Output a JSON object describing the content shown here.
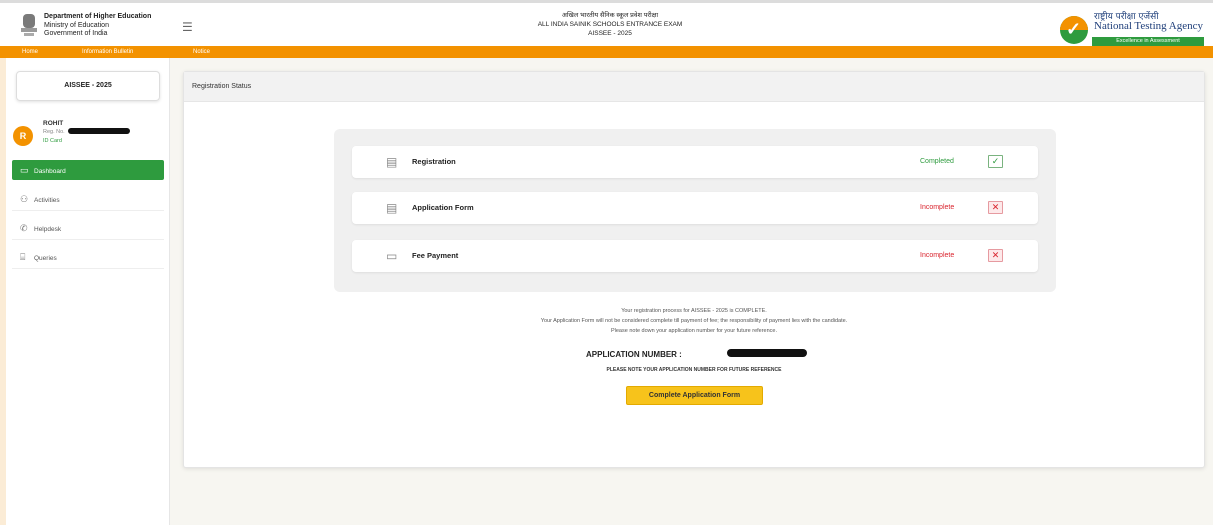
{
  "header": {
    "dept_line1": "Department of Higher Education",
    "dept_line2": "Ministry of Education",
    "dept_line3": "Government of India",
    "title_hindi": "अखिल भारतीय सैनिक स्कूल प्रवेश परीक्षा",
    "title_en": "ALL INDIA SAINIK SCHOOLS ENTRANCE EXAM",
    "title_session": "AISSEE - 2025",
    "nta_hindi": "राष्ट्रीय परीक्षा एजेंसी",
    "nta_en": "National Testing Agency",
    "nta_tag": "Excellence in Assessment",
    "menu_icon": "hamburger-icon"
  },
  "nav": {
    "items": [
      "Home",
      "Information Bulletin",
      "Notice"
    ]
  },
  "sidebar": {
    "exam_label": "AISSEE - 2025",
    "user_initial": "R",
    "user_name": "ROHIT",
    "user_sub": "Reg. No.",
    "user_link": "ID Card",
    "items": [
      {
        "label": "Dashboard",
        "icon": "dashboard-icon",
        "active": true
      },
      {
        "label": "Activities",
        "icon": "activities-icon",
        "active": false
      },
      {
        "label": "Helpdesk",
        "icon": "phone-icon",
        "active": false
      },
      {
        "label": "Queries",
        "icon": "queries-icon",
        "active": false
      }
    ]
  },
  "main": {
    "section_title": "Registration Status",
    "rows": [
      {
        "label": "Registration",
        "status": "Completed",
        "state": "ok",
        "icon": "registration-icon"
      },
      {
        "label": "Application Form",
        "status": "Incomplete",
        "state": "bad",
        "icon": "form-icon"
      },
      {
        "label": "Fee Payment",
        "status": "Incomplete",
        "state": "bad",
        "icon": "payment-icon"
      }
    ],
    "message_line1": "Your registration process for AISSEE - 2025 is COMPLETE.",
    "message_line2": "Your Application Form will not be considered complete till payment of fee; the responsibility of payment lies with the candidate.",
    "message_line3": "Please note down your application number for your future reference.",
    "app_no_label": "APPLICATION NUMBER :",
    "note": "PLEASE NOTE YOUR APPLICATION NUMBER FOR FUTURE REFERENCE",
    "cta_label": "Complete Application Form"
  },
  "colors": {
    "brand_orange": "#f39200",
    "brand_green": "#2e9b3e",
    "error_red": "#d9232d",
    "cta_yellow": "#f7c31b"
  }
}
